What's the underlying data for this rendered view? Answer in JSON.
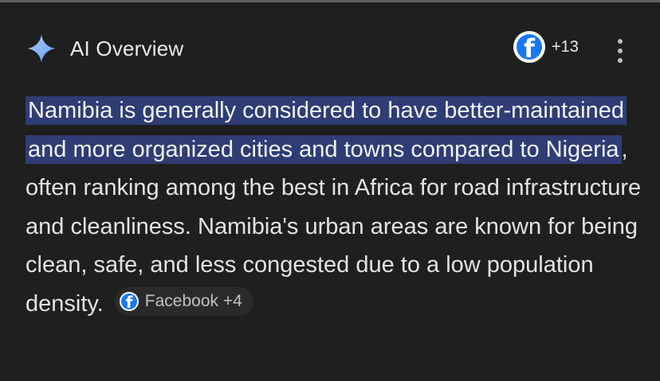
{
  "header": {
    "title": "AI Overview",
    "icon": "sparkle-icon"
  },
  "sources": {
    "icon": "facebook-icon",
    "count": "+13"
  },
  "menu": {
    "icon": "more-vert-icon"
  },
  "overview": {
    "highlighted": "Namibia is generally considered to have better-maintained and more organized cities and towns compared to Nigeria",
    "rest": ", often ranking among the best in Africa for road infrastructure and cleanliness. Namibia's urban areas are known for being clean, safe, and less congested due to a low population density.",
    "chip": {
      "icon": "facebook-icon",
      "label": "Facebook +4"
    }
  },
  "colors": {
    "background": "#1f1f1f",
    "highlight": "#303c74",
    "facebook": "#1877f2",
    "sparkle": "#8ab4f8"
  }
}
